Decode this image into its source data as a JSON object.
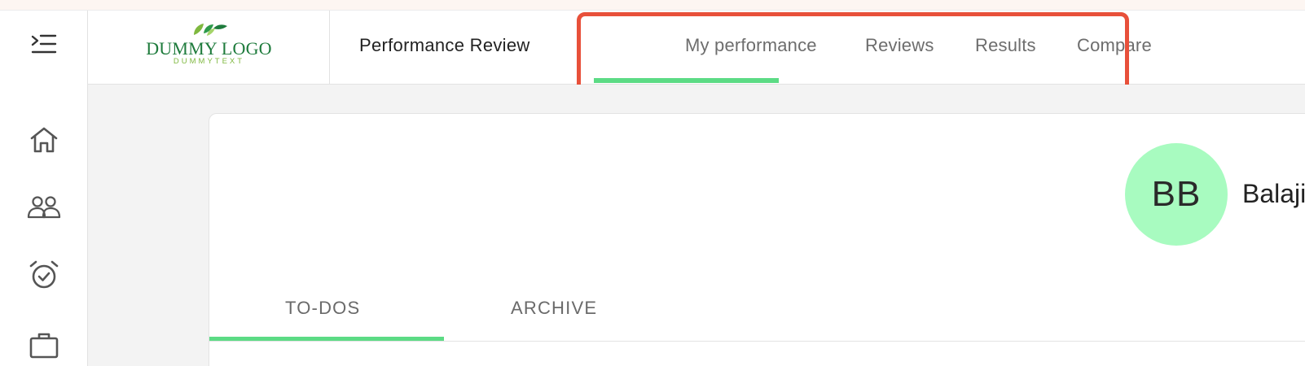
{
  "header": {
    "logo": {
      "main": "DUMMY LOGO",
      "sub": "DUMMYTEXT"
    },
    "app_title": "Performance Review",
    "nav_tabs": [
      {
        "label": "My performance",
        "active": true
      },
      {
        "label": "Reviews",
        "active": false
      },
      {
        "label": "Results",
        "active": false
      },
      {
        "label": "Compare",
        "active": false
      }
    ]
  },
  "sidebar": {
    "items": [
      {
        "icon": "menu-expand-icon"
      },
      {
        "icon": "home-icon"
      },
      {
        "icon": "people-icon"
      },
      {
        "icon": "alarm-check-icon"
      },
      {
        "icon": "briefcase-icon"
      }
    ]
  },
  "profile": {
    "initials": "BB",
    "name": "Balaji"
  },
  "sub_tabs": [
    {
      "label": "TO-DOS",
      "active": true
    },
    {
      "label": "ARCHIVE",
      "active": false
    }
  ],
  "colors": {
    "accent": "#5cdb85",
    "avatar_bg": "#a8fbc0",
    "logo_green": "#1e7b3c",
    "logo_light": "#7fb83f",
    "highlight": "#e8503a"
  }
}
